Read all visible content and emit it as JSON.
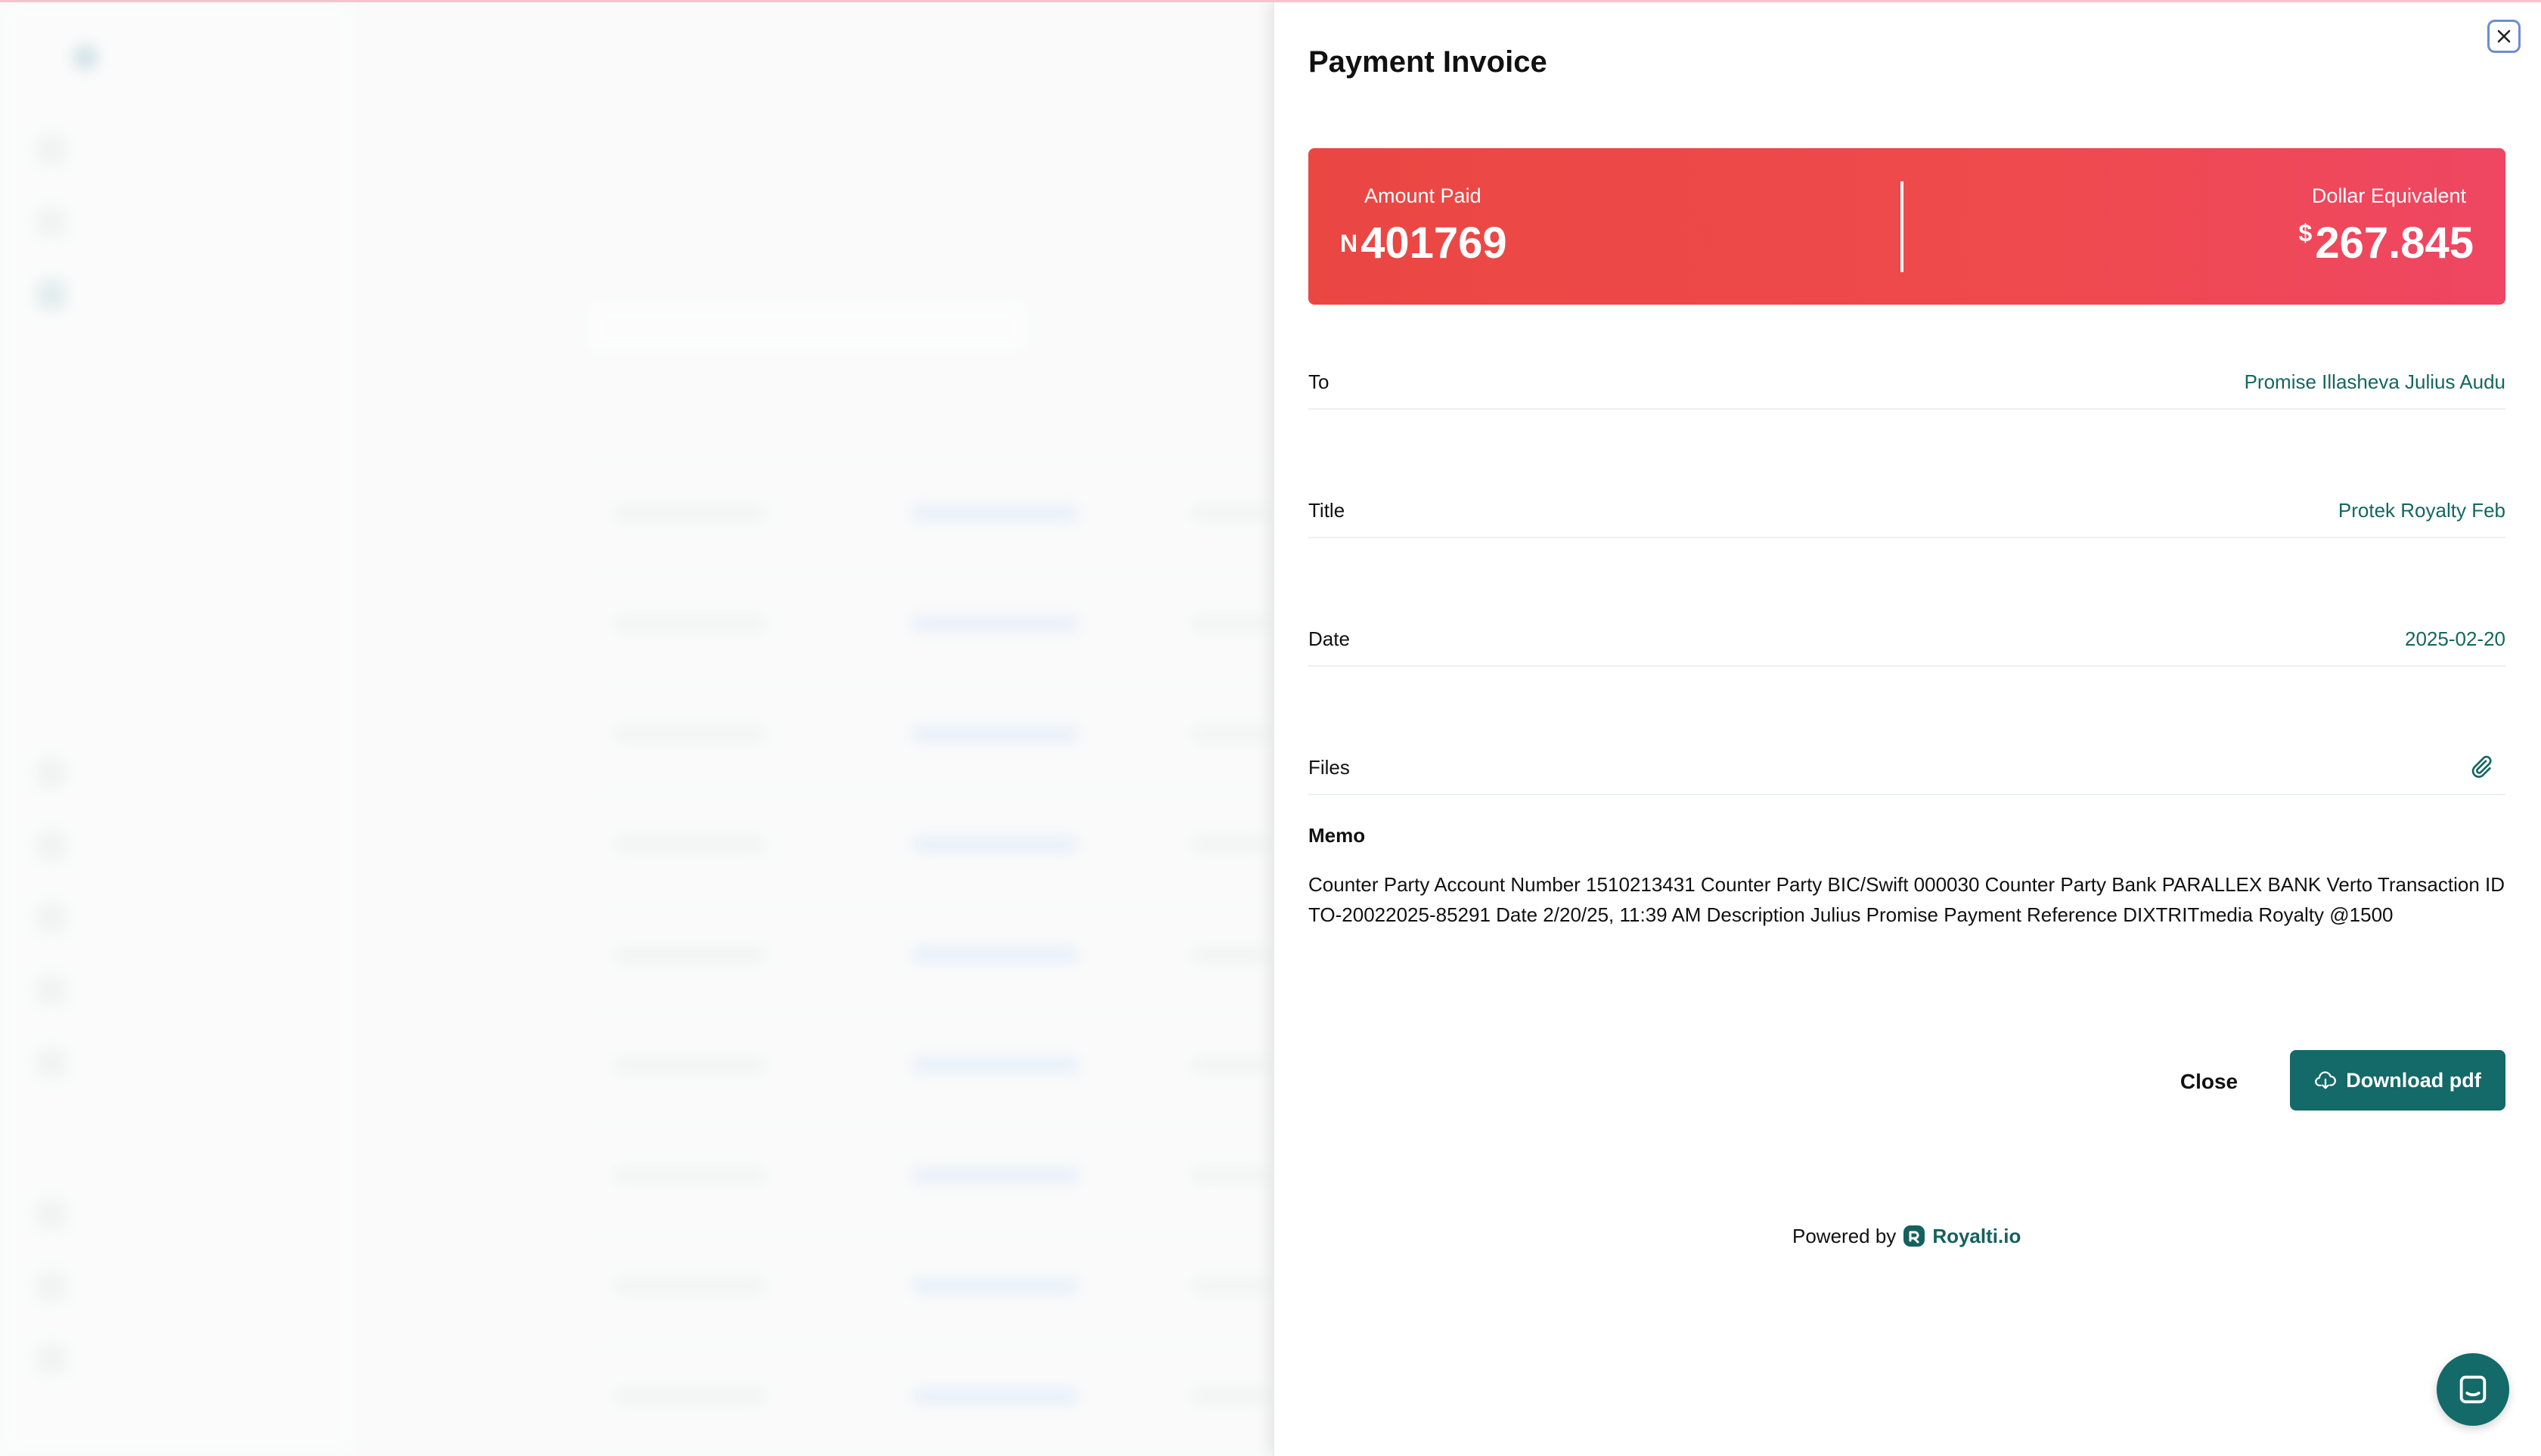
{
  "panel": {
    "title": "Payment Invoice",
    "amount_paid": {
      "label": "Amount Paid",
      "currency_symbol": "N",
      "value": "401769"
    },
    "dollar_equivalent": {
      "label": "Dollar Equivalent",
      "currency_symbol": "$",
      "value": "267.845"
    },
    "fields": {
      "to": {
        "label": "To",
        "value": "Promise Illasheva Julius Audu"
      },
      "title": {
        "label": "Title",
        "value": "Protek Royalty Feb"
      },
      "date": {
        "label": "Date",
        "value": "2025-02-20"
      },
      "files": {
        "label": "Files",
        "icon": "paperclip-icon"
      }
    },
    "memo": {
      "label": "Memo",
      "text": "Counter Party Account Number 1510213431 Counter Party BIC/Swift 000030 Counter Party Bank PARALLEX BANK Verto Transaction ID TO-20022025-85291 Date 2/20/25, 11:39 AM Description Julius Promise Payment Reference DIXTRITmedia Royalty @1500"
    },
    "buttons": {
      "close": "Close",
      "download": "Download pdf"
    },
    "footer": {
      "powered_by": "Powered by",
      "brand": "Royalti.io"
    }
  },
  "colors": {
    "accent": "#136a68",
    "value_text": "#14675f",
    "card_gradient_start": "#ea4743",
    "card_gradient_end": "#ef4663"
  }
}
